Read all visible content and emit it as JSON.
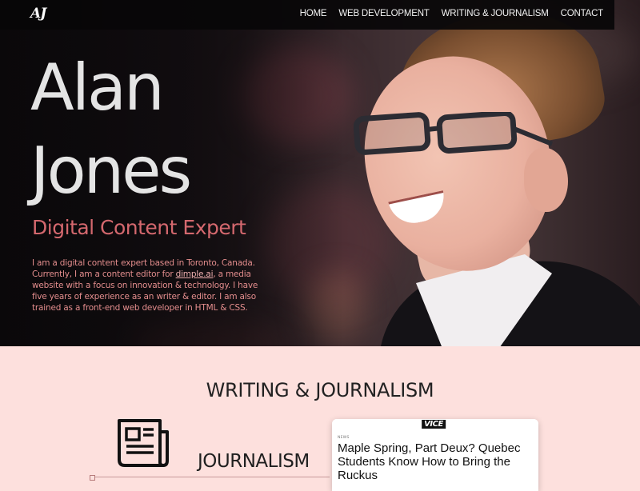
{
  "nav": {
    "logo": "AJ",
    "links": [
      "HOME",
      "WEB DEVELOPMENT",
      "WRITING & JOURNALISM",
      "CONTACT"
    ]
  },
  "hero": {
    "name_line1": "Alan",
    "name_line2": "Jones",
    "title": "Digital Content Expert",
    "bio_before_link": "I am a digital content expert based in Toronto, Canada. Currently, I am a content editor for ",
    "bio_link": "dimple.ai",
    "bio_after_link": ", a media website with a focus on innovation & technology. I have five years of experience as an writer & editor. I am also trained as a front-end web developer in HTML & CSS."
  },
  "writing": {
    "heading": "WRITING & JOURNALISM",
    "journalism_label": "JOURNALISM",
    "icon": "newspaper-icon",
    "article": {
      "masthead": "VICE",
      "kicker": "NEWS",
      "headline": "Maple Spring, Part Deux? Quebec Students Know How to Bring the Ruckus"
    }
  },
  "colors": {
    "accent": "#d4686e",
    "section_bg": "#fde0dd",
    "nav_bg": "#080608"
  }
}
